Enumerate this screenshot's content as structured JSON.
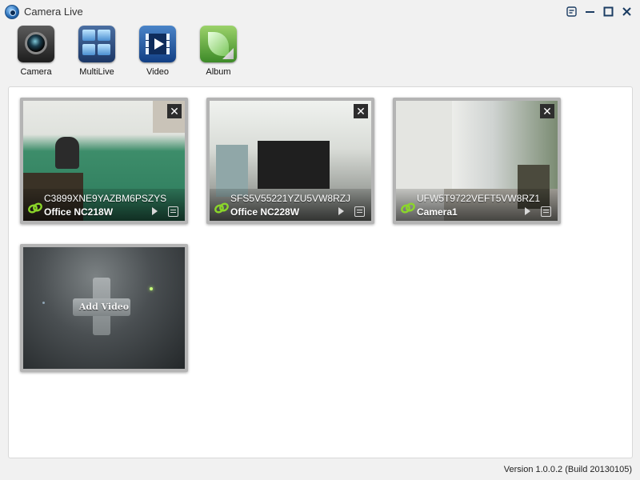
{
  "window": {
    "title": "Camera Live",
    "controls": [
      "settings",
      "minimize",
      "maximize",
      "close"
    ]
  },
  "toolbar": {
    "items": [
      {
        "label": "Camera",
        "icon": "camera-icon"
      },
      {
        "label": "MultiLive",
        "icon": "multilive-icon"
      },
      {
        "label": "Video",
        "icon": "video-icon"
      },
      {
        "label": "Album",
        "icon": "album-icon"
      }
    ]
  },
  "cameras": [
    {
      "uid": "C3899XNE9YAZBM6PSZYS",
      "name": "Office NC218W",
      "status_icon": "link-icon"
    },
    {
      "uid": "SFS5V55221YZU5VW8RZJ",
      "name": "Office NC228W",
      "status_icon": "link-icon"
    },
    {
      "uid": "UFW5T9722VEFT5VW8RZ1",
      "name": "Camera1",
      "status_icon": "link-icon"
    }
  ],
  "add_video": {
    "label": "Add Video"
  },
  "footer": {
    "version": "Version 1.0.0.2 (Build 20130105)"
  },
  "colors": {
    "link_status": "#8bd62a",
    "tile_border": "#b4b4b4",
    "window_bg": "#f1f1f1"
  }
}
